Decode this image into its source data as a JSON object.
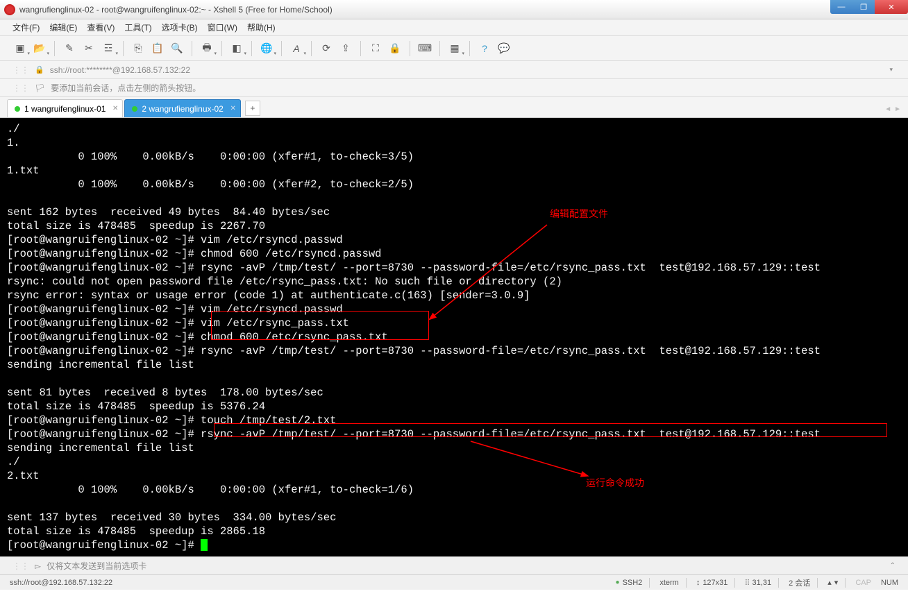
{
  "window": {
    "title": "wangrufienglinux-02 - root@wangruifenglinux-02:~ - Xshell 5 (Free for Home/School)"
  },
  "menubar": {
    "file": "文件(F)",
    "edit": "编辑(E)",
    "view": "查看(V)",
    "tools": "工具(T)",
    "tabs": "选项卡(B)",
    "window": "窗口(W)",
    "help": "帮助(H)"
  },
  "addressbar": {
    "url": "ssh://root:********@192.168.57.132:22"
  },
  "infobar": {
    "text": "要添加当前会话，点击左侧的箭头按钮。"
  },
  "tabs": {
    "tab1": "1 wangruifenglinux-01",
    "tab2": "2 wangrufienglinux-02"
  },
  "terminal": {
    "lines": [
      "./",
      "1.",
      "           0 100%    0.00kB/s    0:00:00 (xfer#1, to-check=3/5)",
      "1.txt",
      "           0 100%    0.00kB/s    0:00:00 (xfer#2, to-check=2/5)",
      "",
      "sent 162 bytes  received 49 bytes  84.40 bytes/sec",
      "total size is 478485  speedup is 2267.70",
      "[root@wangruifenglinux-02 ~]# vim /etc/rsyncd.passwd",
      "[root@wangruifenglinux-02 ~]# chmod 600 /etc/rsyncd.passwd",
      "[root@wangruifenglinux-02 ~]# rsync -avP /tmp/test/ --port=8730 --password-file=/etc/rsync_pass.txt  test@192.168.57.129::test",
      "rsync: could not open password file /etc/rsync_pass.txt: No such file or directory (2)",
      "rsync error: syntax or usage error (code 1) at authenticate.c(163) [sender=3.0.9]",
      "[root@wangruifenglinux-02 ~]# vim /etc/rsyncd.passwd",
      "[root@wangruifenglinux-02 ~]# vim /etc/rsync_pass.txt",
      "[root@wangruifenglinux-02 ~]# chmod 600 /etc/rsync_pass.txt",
      "[root@wangruifenglinux-02 ~]# rsync -avP /tmp/test/ --port=8730 --password-file=/etc/rsync_pass.txt  test@192.168.57.129::test",
      "sending incremental file list",
      "",
      "sent 81 bytes  received 8 bytes  178.00 bytes/sec",
      "total size is 478485  speedup is 5376.24",
      "[root@wangruifenglinux-02 ~]# touch /tmp/test/2.txt",
      "[root@wangruifenglinux-02 ~]# rsync -avP /tmp/test/ --port=8730 --password-file=/etc/rsync_pass.txt  test@192.168.57.129::test",
      "sending incremental file list",
      "./",
      "2.txt",
      "           0 100%    0.00kB/s    0:00:00 (xfer#1, to-check=1/6)",
      "",
      "sent 137 bytes  received 30 bytes  334.00 bytes/sec",
      "total size is 478485  speedup is 2865.18",
      "[root@wangruifenglinux-02 ~]# "
    ],
    "annotation1": "编辑配置文件",
    "annotation2": "运行命令成功"
  },
  "footer_input": {
    "placeholder": "仅将文本发送到当前选项卡"
  },
  "statusbar": {
    "conn": "ssh://root@192.168.57.132:22",
    "ssh": "SSH2",
    "term": "xterm",
    "size": "127x31",
    "pos": "31,31",
    "sessions": "2 会话",
    "cap": "CAP",
    "num": "NUM"
  }
}
